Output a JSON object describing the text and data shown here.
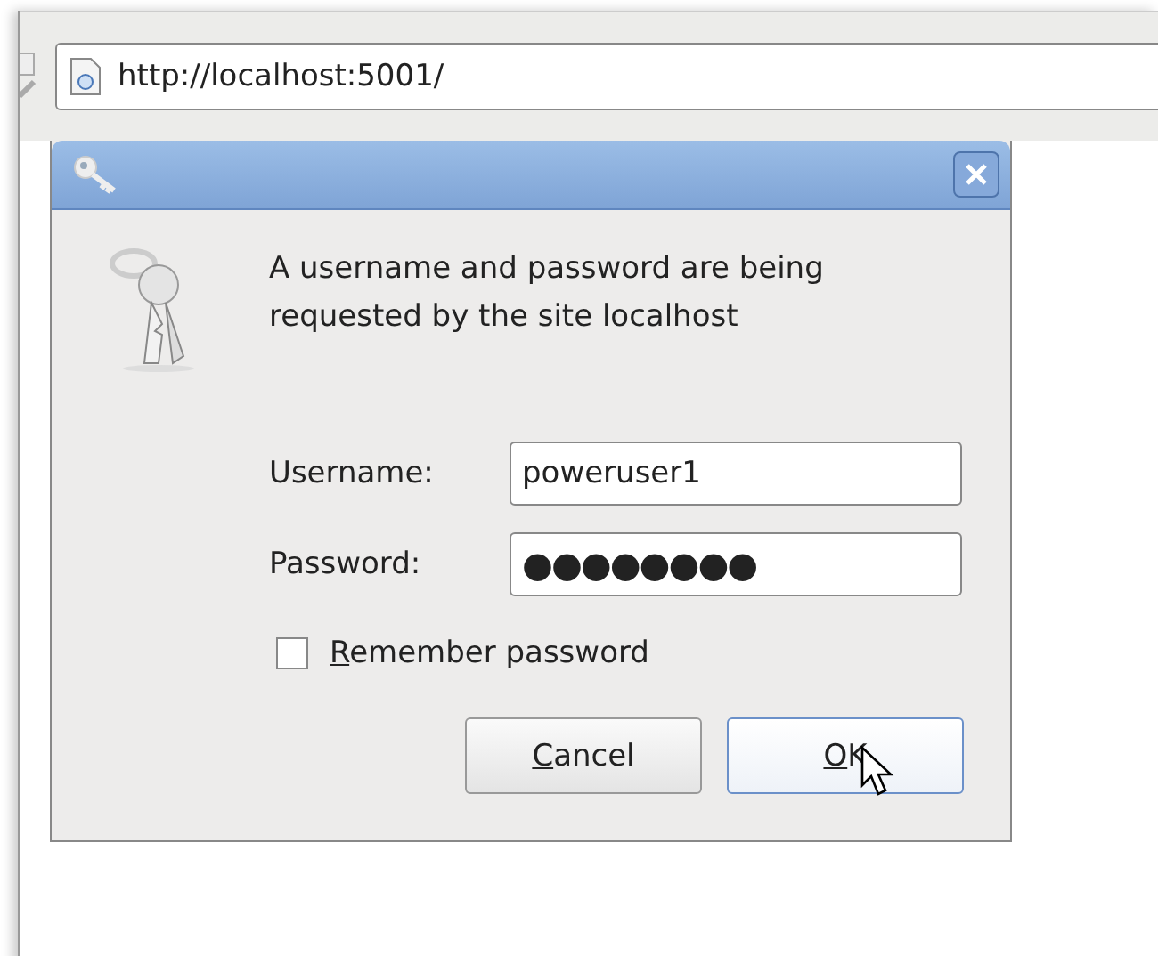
{
  "address_bar": {
    "url": "http://localhost:5001/"
  },
  "dialog": {
    "message": "A username and password are being requested by the site localhost",
    "fields": [
      {
        "label": "Username:",
        "value": "poweruser1"
      },
      {
        "label": "Password:",
        "value": "●●●●●●●●"
      }
    ],
    "remember": {
      "label": "Remember password",
      "checked": false
    },
    "buttons": [
      {
        "label": "Cancel",
        "focused": false
      },
      {
        "label": "OK",
        "focused": true
      }
    ]
  }
}
